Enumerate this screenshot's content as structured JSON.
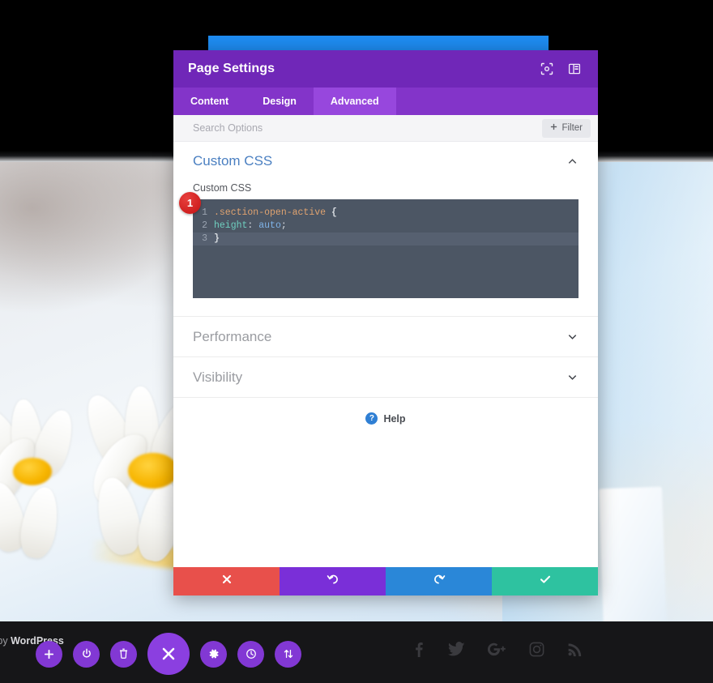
{
  "modal": {
    "title": "Page Settings",
    "header_icons": [
      {
        "name": "target-focus-icon",
        "label": "Focus"
      },
      {
        "name": "panel-layout-icon",
        "label": "Layout"
      }
    ],
    "tabs": [
      {
        "label": "Content",
        "active": false
      },
      {
        "label": "Design",
        "active": false
      },
      {
        "label": "Advanced",
        "active": true
      }
    ],
    "search": {
      "placeholder": "Search Options",
      "value": "",
      "filter_label": "Filter",
      "filter_icon": "plus-icon"
    },
    "sections": {
      "custom_css": {
        "title": "Custom CSS",
        "expanded": true,
        "chevron": "chevron-up-icon",
        "field_label": "Custom CSS",
        "step_badge": "1",
        "code_lines": [
          {
            "num": "1",
            "active": false,
            "tokens": [
              {
                "type": "sel",
                "text": ".section-open-active"
              },
              {
                "type": "space",
                "text": " "
              },
              {
                "type": "brace",
                "text": "{"
              }
            ]
          },
          {
            "num": "2",
            "active": false,
            "tokens": [
              {
                "type": "prop",
                "text": "height"
              },
              {
                "type": "punc",
                "text": ":"
              },
              {
                "type": "space",
                "text": " "
              },
              {
                "type": "val",
                "text": "auto"
              },
              {
                "type": "punc",
                "text": ";"
              }
            ]
          },
          {
            "num": "3",
            "active": true,
            "tokens": [
              {
                "type": "brace",
                "text": "}"
              }
            ]
          }
        ]
      }
    },
    "collapsed_sections": [
      {
        "label": "Performance",
        "chevron": "chevron-down-icon"
      },
      {
        "label": "Visibility",
        "chevron": "chevron-down-icon"
      }
    ],
    "help": {
      "label": "Help",
      "icon": "question-mark-icon",
      "badge": "?"
    },
    "footer_buttons": [
      {
        "name": "cancel-button",
        "icon": "close-x-icon",
        "color": "#e8504b"
      },
      {
        "name": "undo-button",
        "icon": "undo-arrow-icon",
        "color": "#7a2fd8"
      },
      {
        "name": "redo-button",
        "icon": "redo-arrow-icon",
        "color": "#2a87d8"
      },
      {
        "name": "save-button",
        "icon": "checkmark-icon",
        "color": "#2ec2a0"
      }
    ]
  },
  "bottom_bar": {
    "credit_prefix": "d by ",
    "credit_brand": "WordPress",
    "fabs": [
      {
        "name": "add-button",
        "icon": "plus-icon"
      },
      {
        "name": "power-button",
        "icon": "power-icon"
      },
      {
        "name": "trash-button",
        "icon": "trash-icon"
      },
      {
        "name": "close-builder-button",
        "icon": "close-x-icon",
        "large": true
      },
      {
        "name": "settings-button",
        "icon": "gear-icon"
      },
      {
        "name": "history-button",
        "icon": "clock-icon"
      },
      {
        "name": "reorder-button",
        "icon": "sort-arrows-icon"
      }
    ],
    "social": [
      {
        "name": "facebook-icon",
        "glyph": "f"
      },
      {
        "name": "twitter-icon",
        "glyph": "twitter"
      },
      {
        "name": "googleplus-icon",
        "glyph": "G+"
      },
      {
        "name": "instagram-icon",
        "glyph": "instagram"
      },
      {
        "name": "rss-icon",
        "glyph": "rss"
      }
    ]
  },
  "colors": {
    "modal_header": "#7027b8",
    "tab_bar": "#8334c9",
    "tab_active": "#9747dd",
    "section_title": "#4a7fc1",
    "editor_bg": "#4c5664",
    "badge_red": "#cf1f1f",
    "blue_bar": "#1e8cf1",
    "fab_purple": "#8238d4"
  }
}
